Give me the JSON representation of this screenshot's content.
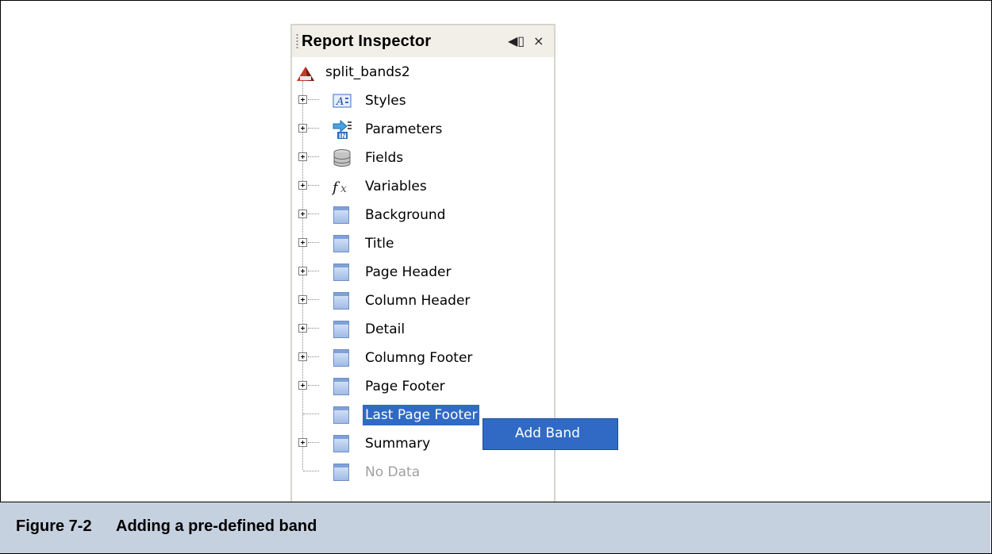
{
  "caption": {
    "number": "Figure 7-2",
    "text": "Adding a pre-defined band"
  },
  "inspector": {
    "title": "Report Inspector",
    "header_buttons": {
      "minimize_icon": "◀▯",
      "close_icon": "×"
    },
    "root": {
      "label": "split_bands2",
      "icon": "report-icon"
    },
    "nodes": [
      {
        "label": "Styles",
        "icon": "styles-icon",
        "expandable": true,
        "state": "normal"
      },
      {
        "label": "Parameters",
        "icon": "parameters-icon",
        "expandable": true,
        "state": "normal"
      },
      {
        "label": "Fields",
        "icon": "fields-icon",
        "expandable": true,
        "state": "normal"
      },
      {
        "label": "Variables",
        "icon": "variables-icon",
        "expandable": true,
        "state": "normal"
      },
      {
        "label": "Background",
        "icon": "band-icon",
        "expandable": true,
        "state": "normal"
      },
      {
        "label": "Title",
        "icon": "band-icon",
        "expandable": true,
        "state": "normal"
      },
      {
        "label": "Page Header",
        "icon": "band-icon",
        "expandable": true,
        "state": "normal"
      },
      {
        "label": "Column Header",
        "icon": "band-icon",
        "expandable": true,
        "state": "normal"
      },
      {
        "label": "Detail",
        "icon": "band-icon",
        "expandable": true,
        "state": "normal"
      },
      {
        "label": "Columng Footer",
        "icon": "band-icon",
        "expandable": true,
        "state": "normal"
      },
      {
        "label": "Page Footer",
        "icon": "band-icon",
        "expandable": true,
        "state": "normal"
      },
      {
        "label": "Last Page Footer",
        "icon": "band-icon",
        "expandable": false,
        "state": "selected"
      },
      {
        "label": "Summary",
        "icon": "band-icon",
        "expandable": true,
        "state": "normal"
      },
      {
        "label": "No Data",
        "icon": "band-icon",
        "expandable": false,
        "state": "disabled"
      }
    ]
  },
  "context_menu": {
    "items": [
      {
        "label": "Add Band"
      }
    ]
  },
  "colors": {
    "caption_background": "#c6d1e0",
    "selection": "#316ac5",
    "panel_header": "#f1efe7",
    "disabled_text": "#a0a0a0"
  }
}
